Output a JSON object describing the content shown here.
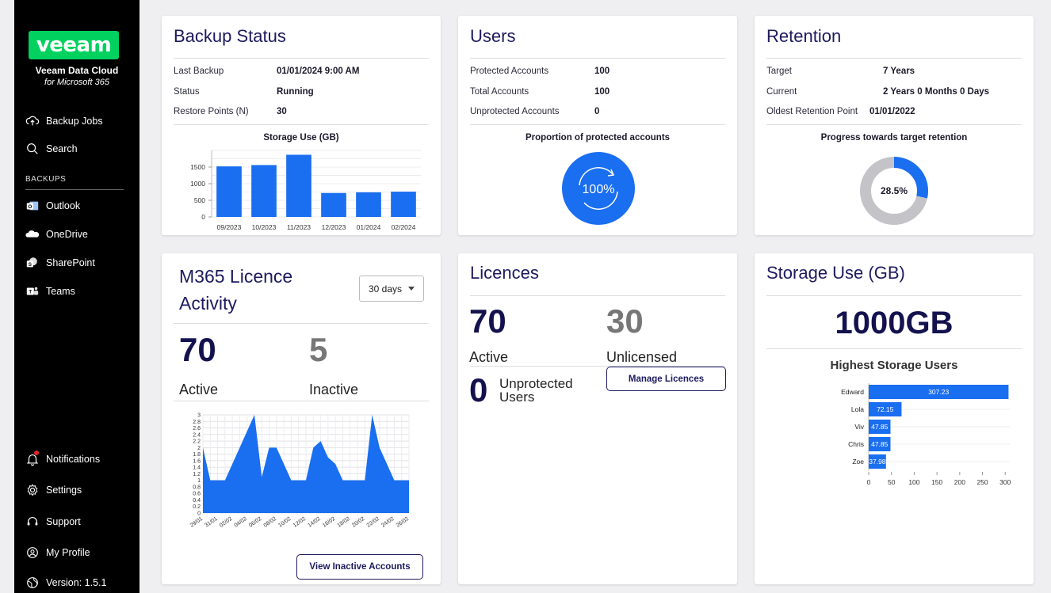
{
  "sidebar": {
    "logo": "veeam",
    "title": "Veeam Data Cloud",
    "subtitle": "for Microsoft 365",
    "top_items": [
      {
        "label": "Backup Jobs",
        "icon": "cloud-upload-icon"
      },
      {
        "label": "Search",
        "icon": "search-icon"
      }
    ],
    "section_label": "BACKUPS",
    "backup_items": [
      {
        "label": "Outlook",
        "icon": "outlook-icon"
      },
      {
        "label": "OneDrive",
        "icon": "onedrive-icon"
      },
      {
        "label": "SharePoint",
        "icon": "sharepoint-icon"
      },
      {
        "label": "Teams",
        "icon": "teams-icon"
      }
    ],
    "bottom_items": [
      {
        "label": "Notifications",
        "icon": "bell-icon"
      },
      {
        "label": "Settings",
        "icon": "gear-icon"
      },
      {
        "label": "Support",
        "icon": "headset-icon"
      },
      {
        "label": "My Profile",
        "icon": "user-icon"
      },
      {
        "label": "Version: 1.5.1",
        "icon": "globe-icon"
      }
    ]
  },
  "backup_status": {
    "title": "Backup Status",
    "rows": [
      {
        "key": "Last Backup",
        "value": "01/01/2024 9:00 AM"
      },
      {
        "key": "Status",
        "value": "Running"
      },
      {
        "key": "Restore Points (N)",
        "value": "30"
      }
    ],
    "chart_title": "Storage Use (GB)"
  },
  "users": {
    "title": "Users",
    "rows": [
      {
        "key": "Protected Accounts",
        "value": "100"
      },
      {
        "key": "Total Accounts",
        "value": "100"
      },
      {
        "key": "Unprotected Accounts",
        "value": "0"
      }
    ],
    "chart_title": "Proportion of protected accounts",
    "percent_label": "100%",
    "percent": 100
  },
  "retention": {
    "title": "Retention",
    "rows": [
      {
        "key": "Target",
        "value": "7 Years"
      },
      {
        "key": "Current",
        "value": "2 Years 0 Months 0 Days"
      },
      {
        "key": "Oldest Retention Point",
        "value": "01/01/2022"
      }
    ],
    "chart_title": "Progress towards target retention",
    "percent_label": "28.5%",
    "percent": 28.5
  },
  "licence_activity": {
    "title_line1": "M365 Licence",
    "title_line2": "Activity",
    "range": "30 days",
    "active_value": "70",
    "active_label": "Active",
    "inactive_value": "5",
    "inactive_label": "Inactive",
    "button": "View Inactive Accounts"
  },
  "licences": {
    "title": "Licences",
    "active_value": "70",
    "active_label": "Active",
    "unlicensed_value": "30",
    "unlicensed_label": "Unlicensed",
    "unprotected_value": "0",
    "unprotected_label_1": "Unprotected",
    "unprotected_label_2": "Users",
    "button": "Manage Licences"
  },
  "storage": {
    "title": "Storage Use (GB)",
    "total": "1000GB",
    "chart_title": "Highest Storage Users"
  },
  "colors": {
    "accent": "#1a6ef0",
    "navy": "#1d1a5e",
    "gray_ring": "#c4c4c8",
    "logo_green": "#00d15f"
  },
  "chart_data": [
    {
      "type": "bar",
      "categories": [
        "09/2023",
        "10/2023",
        "11/2023",
        "12/2023",
        "01/2024",
        "02/2024"
      ],
      "values": [
        1520,
        1560,
        1870,
        720,
        740,
        760
      ],
      "yticks": [
        0,
        500,
        1000,
        1500
      ],
      "ylim": [
        0,
        2000
      ]
    },
    {
      "type": "area",
      "x": [
        "29/01",
        "30/01",
        "31/01",
        "01/02",
        "02/02",
        "03/02",
        "04/02",
        "05/02",
        "06/02",
        "07/02",
        "08/02",
        "09/02",
        "10/02",
        "11/02",
        "12/02",
        "13/02",
        "14/02",
        "15/02",
        "16/02",
        "17/02",
        "18/02",
        "19/02",
        "20/02",
        "21/02",
        "22/02",
        "23/02",
        "24/02",
        "25/02",
        "26/02"
      ],
      "xticks": [
        "29/01",
        "31/01",
        "02/02",
        "04/02",
        "06/02",
        "08/02",
        "10/02",
        "12/02",
        "14/02",
        "16/02",
        "18/02",
        "20/02",
        "22/02",
        "24/02",
        "26/02"
      ],
      "values": [
        2,
        1,
        1,
        1,
        1.5,
        2,
        2.5,
        3,
        1.1,
        2,
        2,
        1.5,
        1,
        1,
        1,
        2,
        2.2,
        1.7,
        1.5,
        1,
        1,
        1,
        1,
        3,
        2,
        1.5,
        1,
        1,
        1
      ],
      "yticks": [
        0,
        0.2,
        0.4,
        0.6,
        0.8,
        1,
        1.2,
        1.4,
        1.6,
        1.8,
        2,
        2.2,
        2.4,
        2.6,
        2.8,
        3
      ],
      "ylim": [
        0,
        3
      ]
    },
    {
      "type": "bar",
      "orientation": "horizontal",
      "categories": [
        "Edward",
        "Lola",
        "Viv",
        "Chris",
        "Zoe"
      ],
      "values": [
        307.23,
        72.15,
        47.85,
        47.85,
        37.98
      ],
      "xticks": [
        0,
        50,
        100,
        150,
        200,
        250,
        300
      ],
      "xlim": [
        0,
        310
      ]
    }
  ]
}
